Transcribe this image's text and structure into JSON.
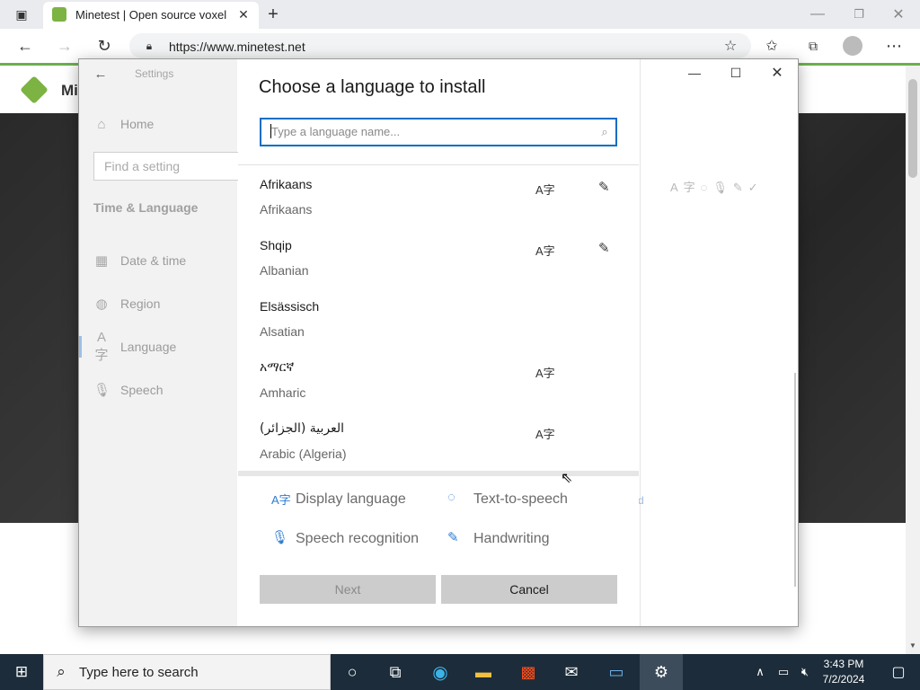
{
  "browser": {
    "tab_title": "Minetest | Open source voxel ga",
    "url": "https://www.minetest.net",
    "site_label": "Mi"
  },
  "settings": {
    "header": "Settings",
    "home": "Home",
    "find_placeholder": "Find a setting",
    "section": "Time & Language",
    "nav": [
      {
        "label": "Date & time",
        "icon": "calendar-icon"
      },
      {
        "label": "Region",
        "icon": "globe-icon"
      },
      {
        "label": "Language",
        "icon": "language-icon"
      },
      {
        "label": "Speech",
        "icon": "microphone-icon"
      }
    ]
  },
  "dialog": {
    "title": "Choose a language to install",
    "search_placeholder": "Type a language name...",
    "languages": [
      {
        "native": "Afrikaans",
        "english": "Afrikaans"
      },
      {
        "native": "Shqip",
        "english": "Albanian"
      },
      {
        "native": "Elsässisch",
        "english": "Alsatian"
      },
      {
        "native": "አማርኛ",
        "english": "Amharic"
      },
      {
        "native": "العربية (الجزائر)",
        "english": "Arabic (Algeria)"
      }
    ],
    "legend": {
      "display": "Display language",
      "tts": "Text-to-speech",
      "speech": "Speech recognition",
      "handwriting": "Handwriting"
    },
    "next": "Next",
    "cancel": "Cancel"
  },
  "taskbar": {
    "search_placeholder": "Type here to search",
    "time": "3:43 PM",
    "date": "7/2/2024"
  }
}
